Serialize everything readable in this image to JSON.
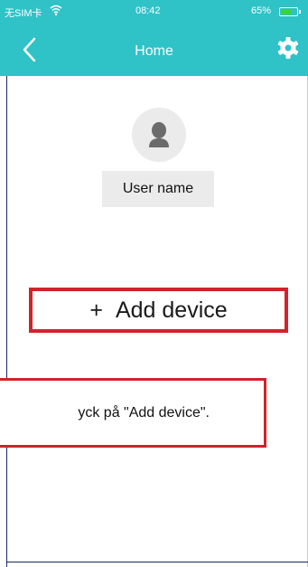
{
  "status_bar": {
    "carrier": "无SIM卡",
    "time": "08:42",
    "battery_pct": "65%",
    "battery_level": 0.65
  },
  "nav": {
    "title": "Home",
    "back_icon": "chevron-left-icon",
    "settings_icon": "gear-icon"
  },
  "profile": {
    "avatar_icon": "user-icon",
    "username": "User name"
  },
  "add_device": {
    "plus": "+",
    "label": "Add device"
  },
  "instruction": {
    "text": "yck på \"Add device\"."
  },
  "colors": {
    "header": "#2fc2c7",
    "highlight_red": "#d1232a",
    "avatar_bg": "#ebebeb",
    "battery_fill": "#3bd43b"
  }
}
